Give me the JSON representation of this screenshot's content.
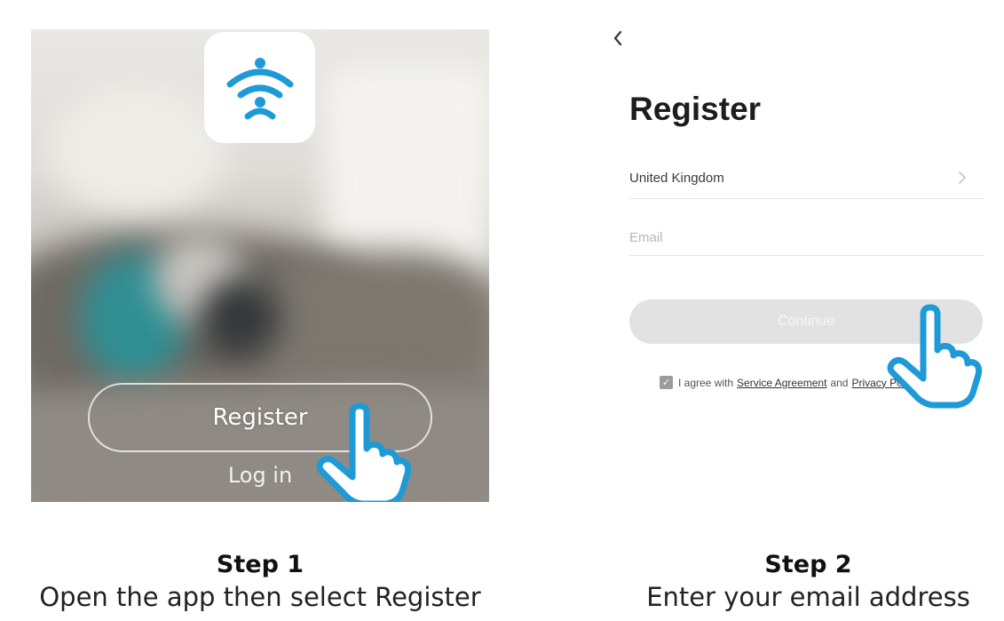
{
  "step1": {
    "register_button": "Register",
    "login_link": "Log in",
    "app_icon": "wifi-app-icon",
    "caption_step": "Step 1",
    "caption_desc": "Open the app then select Register"
  },
  "step2": {
    "title": "Register",
    "country": "United Kingdom",
    "email_placeholder": "Email",
    "continue_label": "Continue",
    "agree_prefix": "I agree with",
    "service_agreement": "Service Agreement",
    "agree_and": "and",
    "privacy_policy": "Privacy Policy",
    "caption_step": "Step 2",
    "caption_desc": "Enter your email address"
  },
  "colors": {
    "accent_blue": "#1e9ad6",
    "continue_disabled": "#e2e2e2"
  }
}
